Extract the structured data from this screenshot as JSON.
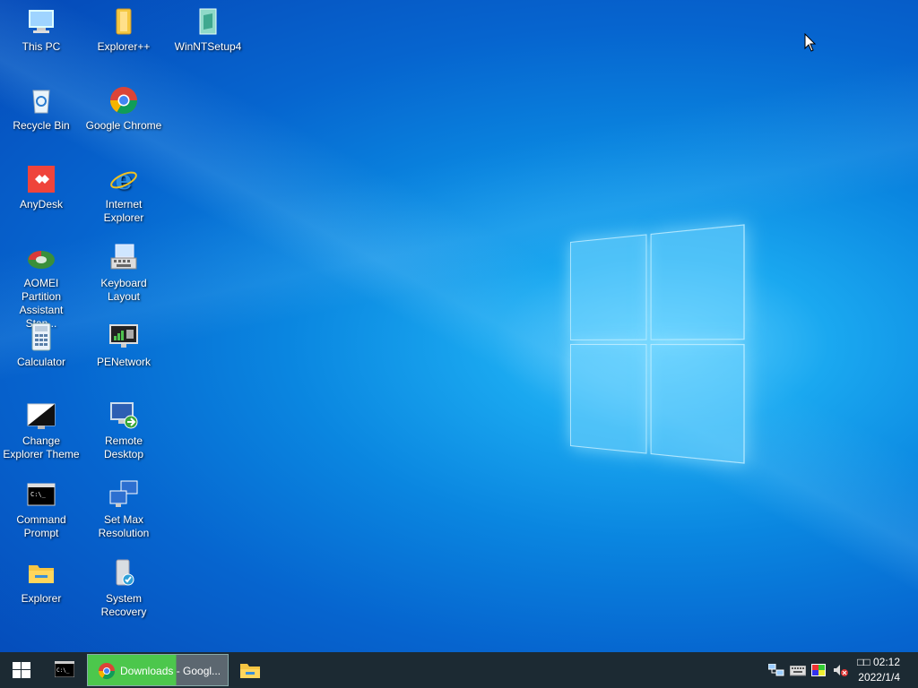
{
  "desktop": {
    "icons": [
      {
        "name": "desktop-icon-this-pc",
        "label": "This PC",
        "icon": "computer-icon"
      },
      {
        "name": "desktop-icon-explorer-plus",
        "label": "Explorer++",
        "icon": "folder-icon"
      },
      {
        "name": "desktop-icon-winntsetup",
        "label": "WinNTSetup4",
        "icon": "setup-icon"
      },
      {
        "name": "desktop-icon-recycle-bin",
        "label": "Recycle Bin",
        "icon": "recycle-bin-icon"
      },
      {
        "name": "desktop-icon-google-chrome",
        "label": "Google Chrome",
        "icon": "chrome-icon"
      },
      {
        "name": "desktop-icon-anydesk",
        "label": "AnyDesk",
        "icon": "anydesk-icon"
      },
      {
        "name": "desktop-icon-internet-explorer",
        "label": "Internet Explorer",
        "icon": "internet-explorer-icon"
      },
      {
        "name": "desktop-icon-aomei",
        "label": "AOMEI Partition Assistant Stan...",
        "icon": "aomei-icon"
      },
      {
        "name": "desktop-icon-keyboard-layout",
        "label": "Keyboard Layout",
        "icon": "keyboard-icon"
      },
      {
        "name": "desktop-icon-calculator",
        "label": "Calculator",
        "icon": "calculator-icon"
      },
      {
        "name": "desktop-icon-penetwork",
        "label": "PENetwork",
        "icon": "network-monitor-icon"
      },
      {
        "name": "desktop-icon-change-explorer-theme",
        "label": "Change Explorer Theme",
        "icon": "theme-icon"
      },
      {
        "name": "desktop-icon-remote-desktop",
        "label": "Remote Desktop",
        "icon": "remote-desktop-icon"
      },
      {
        "name": "desktop-icon-command-prompt",
        "label": "Command Prompt",
        "icon": "terminal-icon"
      },
      {
        "name": "desktop-icon-set-max-resolution",
        "label": "Set Max Resolution",
        "icon": "resolution-icon"
      },
      {
        "name": "desktop-icon-explorer",
        "label": "Explorer",
        "icon": "folder-icon"
      },
      {
        "name": "desktop-icon-system-recovery",
        "label": "System Recovery",
        "icon": "recovery-icon"
      }
    ]
  },
  "taskbar": {
    "start_icon": "windows-start-icon",
    "pinned_cmd_icon": "terminal-icon",
    "active_window_label": "Downloads - Googl...",
    "pinned_explorer_icon": "file-explorer-icon",
    "tray_icons": [
      "network-icon",
      "keyboard-icon",
      "color-icon",
      "volume-muted-icon"
    ],
    "clock_time": "□□ 02:12",
    "clock_date": "2022/1/4"
  }
}
